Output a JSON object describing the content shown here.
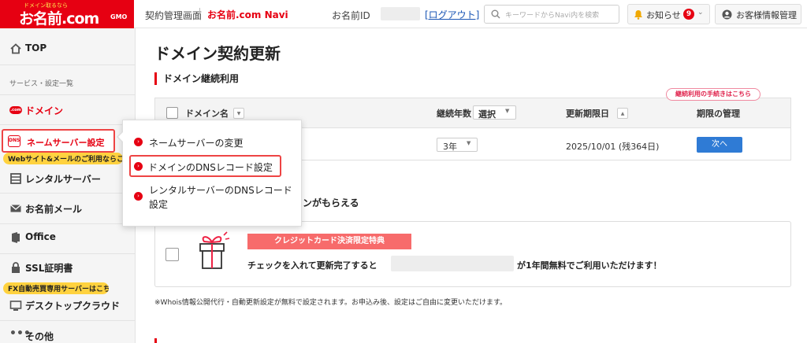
{
  "header": {
    "logo_tagline": "ドメイン取るなら",
    "logo_name": "お名前.com",
    "logo_suffix": "GMO",
    "contract_screen": "契約管理画面",
    "navi_name": "お名前.com Navi",
    "onamae_id_label": "お名前ID",
    "logout_label": "[ログアウト]",
    "search_placeholder": "キーワードからNavi内を検索",
    "notice_label": "お知らせ",
    "notice_count": "9",
    "customer_info_label": "お客様情報管理"
  },
  "sidebar": {
    "top_label": "TOP",
    "section_header": "サービス・設定一覧",
    "domain_label": "ドメイン",
    "nameserver_label": "ネームサーバー設定",
    "nameserver_pill": "Webサイト&メールのご利用ならこちら",
    "rental_label": "レンタルサーバー",
    "mail_label": "お名前メール",
    "office_label": "Office",
    "ssl_label": "SSL証明書",
    "fx_pill": "FX自動売買専用サーバーはこちら",
    "desktop_label": "デスクトップクラウド",
    "other_label": "その他"
  },
  "main": {
    "page_title": "ドメイン契約更新",
    "section1_title": "ドメイン継続利用",
    "renewal_tag": "継続利用の手続きはこちら",
    "table": {
      "col_domain": "ドメイン名",
      "col_years": "継続年数",
      "col_years_select": "選択",
      "col_expiry": "更新期限日",
      "col_manage": "期限の管理",
      "row_years": "3年",
      "row_expiry": "2025/10/01 (残364日)",
      "row_next": "次へ"
    },
    "section2_title_visible": "インがもらえる",
    "promo_ribbon": "クレジットカード決済限定特典",
    "promo_text_before": "チェックを入れて更新完了すると",
    "promo_text_after": "が1年間無料でご利用いただけます！",
    "footnote": "※Whois情報公開代行・自動更新設定が無料で設定されます。お申込み後、設定はご自由に変更いただけます。"
  },
  "popup": {
    "item1": "ネームサーバーの変更",
    "item2": "ドメインのDNSレコード設定",
    "item3": "レンタルサーバーのDNSレコード設定"
  },
  "colors": {
    "brand_red": "#e60012",
    "next_blue": "#2f7bd5",
    "pill_yellow": "#ffd23f",
    "ribbon_red": "#f76b6b"
  }
}
